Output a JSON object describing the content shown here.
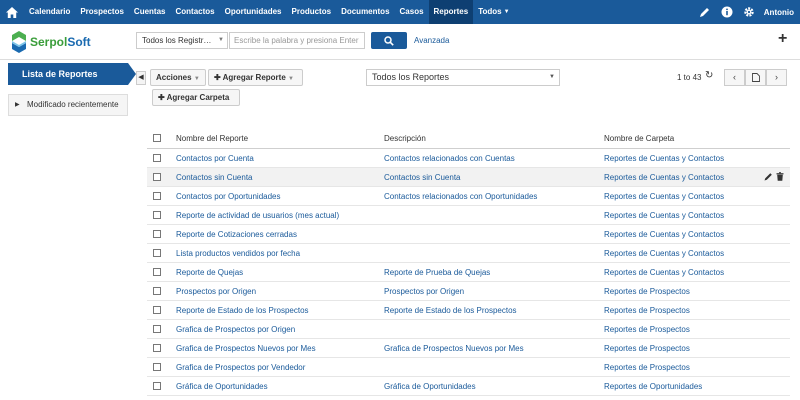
{
  "nav": {
    "items": [
      {
        "label": "Calendario",
        "active": false
      },
      {
        "label": "Prospectos",
        "active": false
      },
      {
        "label": "Cuentas",
        "active": false
      },
      {
        "label": "Contactos",
        "active": false
      },
      {
        "label": "Oportunidades",
        "active": false
      },
      {
        "label": "Productos",
        "active": false
      },
      {
        "label": "Documentos",
        "active": false
      },
      {
        "label": "Casos",
        "active": false
      },
      {
        "label": "Reportes",
        "active": true
      },
      {
        "label": "Todos",
        "active": false
      }
    ],
    "user": "Antonio",
    "icons": [
      "home-icon",
      "pencil-icon",
      "info-icon",
      "gear-icon"
    ]
  },
  "brand": {
    "part1": "Serpol",
    "part2": "Soft"
  },
  "search": {
    "scope": "Todos los Registr…",
    "placeholder": "Escribe la palabra y presiona Enter",
    "advanced": "Avanzada"
  },
  "sidebar": {
    "title": "Lista de Reportes",
    "recent": "Modificado recientemente"
  },
  "toolbar": {
    "actions": "Acciones",
    "add_report": "Agregar Reporte",
    "add_folder": "Agregar Carpeta",
    "filter": "Todos los Reportes",
    "pager": "1 to 43"
  },
  "table": {
    "headers": [
      "Nombre del Reporte",
      "Descripción",
      "Nombre de Carpeta"
    ],
    "rows": [
      {
        "name": "Contactos por Cuenta",
        "desc": "Contactos relacionados con Cuentas",
        "folder": "Reportes de Cuentas y Contactos"
      },
      {
        "name": "Contactos sin Cuenta",
        "desc": "Contactos sin Cuenta",
        "folder": "Reportes de Cuentas y Contactos"
      },
      {
        "name": "Contactos por Oportunidades",
        "desc": "Contactos relacionados con Oportunidades",
        "folder": "Reportes de Cuentas y Contactos"
      },
      {
        "name": "Reporte de actividad de usuarios (mes actual)",
        "desc": "",
        "folder": "Reportes de Cuentas y Contactos"
      },
      {
        "name": "Reporte de Cotizaciones cerradas",
        "desc": "",
        "folder": "Reportes de Cuentas y Contactos"
      },
      {
        "name": "Lista productos vendidos por fecha",
        "desc": "",
        "folder": "Reportes de Cuentas y Contactos"
      },
      {
        "name": "Reporte de Quejas",
        "desc": "Reporte de Prueba de Quejas",
        "folder": "Reportes de Cuentas y Contactos"
      },
      {
        "name": "Prospectos por Origen",
        "desc": "Prospectos por Origen",
        "folder": "Reportes de Prospectos"
      },
      {
        "name": "Reporte de Estado de los Prospectos",
        "desc": "Reporte de Estado de los Prospectos",
        "folder": "Reportes de Prospectos"
      },
      {
        "name": "Grafica de Prospectos por Origen",
        "desc": "",
        "folder": "Reportes de Prospectos"
      },
      {
        "name": "Grafica de Prospectos Nuevos por Mes",
        "desc": "Grafica de Prospectos Nuevos por Mes",
        "folder": "Reportes de Prospectos"
      },
      {
        "name": "Grafica de Prospectos por Vendedor",
        "desc": "",
        "folder": "Reportes de Prospectos"
      },
      {
        "name": "Gráfica de Oportunidades",
        "desc": "Gráfica de Oportunidades",
        "folder": "Reportes de Oportunidades"
      }
    ]
  },
  "colors": {
    "primary": "#1a5a9a",
    "active_nav": "#0e3f72",
    "link": "#1a5a9a"
  }
}
